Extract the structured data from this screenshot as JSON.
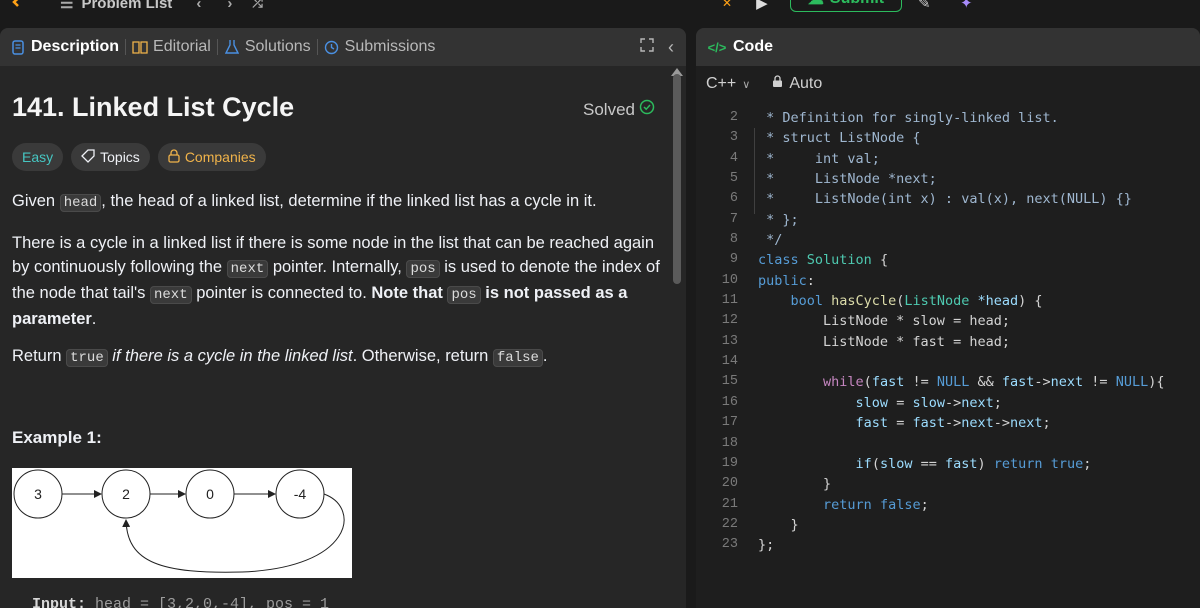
{
  "topbar": {
    "problem_list": "Problem List",
    "submit_label": "Submit"
  },
  "left_tabs": {
    "description": "Description",
    "editorial": "Editorial",
    "solutions": "Solutions",
    "submissions": "Submissions"
  },
  "problem": {
    "title": "141. Linked List Cycle",
    "solved": "Solved",
    "badge_easy": "Easy",
    "badge_topics": "Topics",
    "badge_companies": "Companies",
    "p1_a": "Given ",
    "p1_code": "head",
    "p1_b": ", the head of a linked list, determine if the linked list has a cycle in it.",
    "p2_a": "There is a cycle in a linked list if there is some node in the list that can be reached again by continuously following the ",
    "p2_code1": "next",
    "p2_b": " pointer. Internally, ",
    "p2_code2": "pos",
    "p2_c": " is used to denote the index of the node that tail's ",
    "p2_code3": "next",
    "p2_d": " pointer is connected to. ",
    "p2_bold1": "Note that ",
    "p2_code4": "pos",
    "p2_bold2": " is not passed as a parameter",
    "p2_e": ".",
    "p3_a": "Return ",
    "p3_code1": "true",
    "p3_ital": " if there is a cycle in the linked list",
    "p3_b": ". Otherwise, return ",
    "p3_code2": "false",
    "p3_c": ".",
    "example_title": "Example 1:",
    "example_input_label": "Input:",
    "example_input": " head = [3,2,0,-4], pos = 1",
    "diagram_nodes": [
      "3",
      "2",
      "0",
      "-4"
    ]
  },
  "code_panel": {
    "tab_label": "Code",
    "language": "C++",
    "auto": "Auto",
    "line_numbers": [
      "2",
      "3",
      "4",
      "5",
      "6",
      "7",
      "8",
      "9",
      "10",
      "11",
      "12",
      "13",
      "14",
      "15",
      "16",
      "17",
      "18",
      "19",
      "20",
      "21",
      "22",
      "23"
    ]
  },
  "colors": {
    "accent_green": "#2cbb5d",
    "easy": "#46c6c2",
    "companies": "#f0b34a"
  }
}
